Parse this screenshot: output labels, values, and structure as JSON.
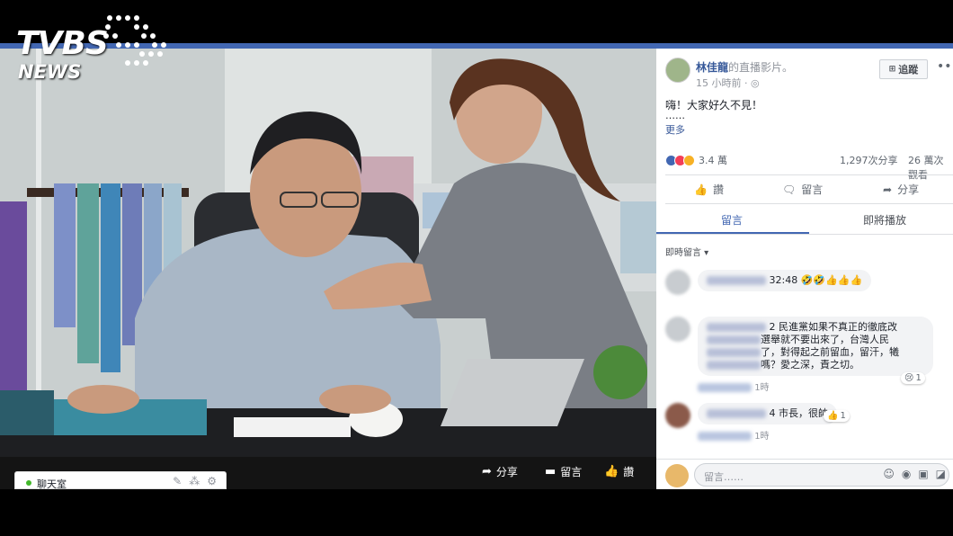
{
  "logo": {
    "brand": "TVBS",
    "sub": "NEWS"
  },
  "post": {
    "author": "林佳龍",
    "author_suffix": "的直播影片。",
    "time": "15 小時前 · ",
    "follow_label": "追蹤",
    "text": "嗨！大家好久不見！",
    "ellipsis": "……",
    "more_link": "更多",
    "reactions_count": "3.4 萬",
    "shares": "1,297次分享",
    "views": "26 萬次觀看"
  },
  "actions": {
    "like": "讚",
    "comment": "留言",
    "share": "分享"
  },
  "tabs": {
    "comments": "留言",
    "replay": "即將播放"
  },
  "filter_label": "即時留言 ▾",
  "comments": [
    {
      "text": "32:48 🤣🤣👍👍👍",
      "meta": ""
    },
    {
      "text_lines": [
        "2 民進黨如果不真正的徹底改",
        "選舉就不要出來了，台灣人民",
        "了，對得起之前留血，留汗，犧",
        "嗎？愛之深，責之切。"
      ],
      "meta": "1時",
      "reaction_count": "1"
    },
    {
      "text": "4 市長，很帥",
      "meta": "1時",
      "reaction_count": "1"
    }
  ],
  "composer_placeholder": "留言……",
  "video_controls": {
    "share": "分享",
    "comment": "留言",
    "like": "讚"
  },
  "chat_label": "聊天室",
  "colors": {
    "fb_blue": "#4267b2",
    "link": "#365899"
  }
}
